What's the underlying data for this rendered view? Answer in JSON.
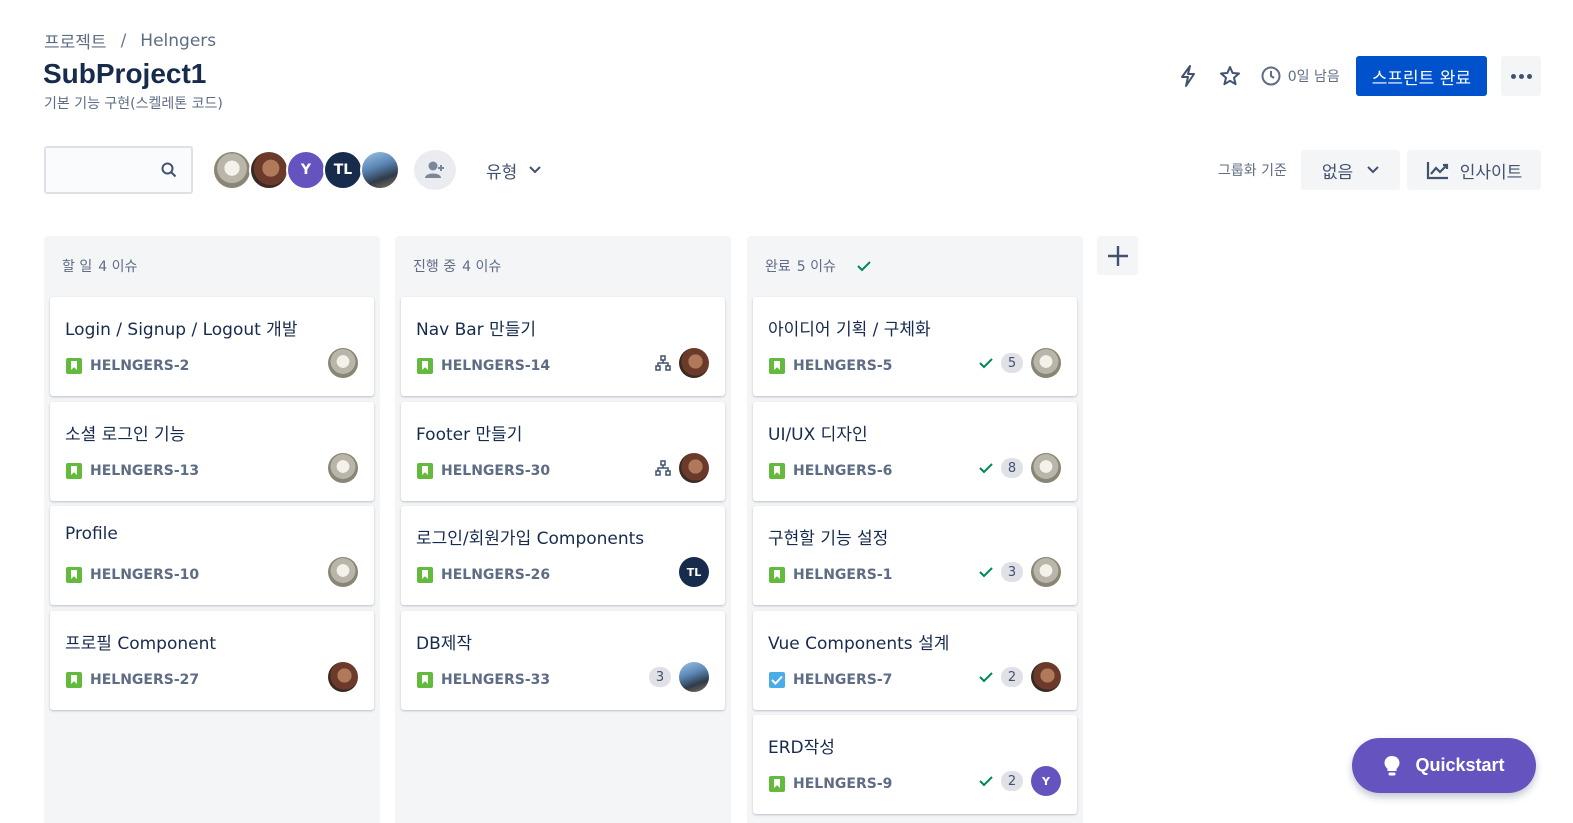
{
  "breadcrumb": {
    "root": "프로젝트",
    "separator": "/",
    "project": "Helngers"
  },
  "header": {
    "title": "SubProject1",
    "subtitle": "기본 기능 구현(스켈레톤 코드)"
  },
  "actions": {
    "remaining": "0일 남음",
    "complete_label": "스프린트 완료"
  },
  "filters": {
    "search_placeholder": "",
    "type_label": "유형",
    "group_label": "그룹화 기준",
    "group_value": "없음",
    "insight_label": "인사이트"
  },
  "avatars": [
    {
      "kind": "dog",
      "initials": ""
    },
    {
      "kind": "face",
      "initials": ""
    },
    {
      "kind": "y",
      "initials": "Y"
    },
    {
      "kind": "tl",
      "initials": "TL"
    },
    {
      "kind": "photo",
      "initials": ""
    }
  ],
  "columns": [
    {
      "name": "할 일",
      "count": "4 이슈",
      "done": false,
      "cards": [
        {
          "summary": "Login / Signup / Logout 개발",
          "key": "HELNGERS-2",
          "type": "story",
          "assignee": "dog"
        },
        {
          "summary": "소셜 로그인 기능",
          "key": "HELNGERS-13",
          "type": "story",
          "assignee": "dog"
        },
        {
          "summary": "Profile",
          "key": "HELNGERS-10",
          "type": "story",
          "assignee": "dog"
        },
        {
          "summary": "프로필 Component",
          "key": "HELNGERS-27",
          "type": "story",
          "assignee": "face"
        }
      ]
    },
    {
      "name": "진행 중",
      "count": "4 이슈",
      "done": false,
      "cards": [
        {
          "summary": "Nav Bar 만들기",
          "key": "HELNGERS-14",
          "type": "story",
          "assignee": "face",
          "subtasks": true
        },
        {
          "summary": "Footer 만들기",
          "key": "HELNGERS-30",
          "type": "story",
          "assignee": "face",
          "subtasks": true
        },
        {
          "summary": "로그인/회원가입 Components",
          "key": "HELNGERS-26",
          "type": "story",
          "assignee": "tl",
          "initials": "TL"
        },
        {
          "summary": "DB제작",
          "key": "HELNGERS-33",
          "type": "story",
          "assignee": "photo",
          "estimate": "3"
        }
      ]
    },
    {
      "name": "완료",
      "count": "5 이슈",
      "done": true,
      "cards": [
        {
          "summary": "아이디어 기획 / 구체화",
          "key": "HELNGERS-5",
          "type": "story",
          "assignee": "dog",
          "estimate": "5",
          "check": true
        },
        {
          "summary": "UI/UX 디자인",
          "key": "HELNGERS-6",
          "type": "story",
          "assignee": "dog",
          "estimate": "8",
          "check": true
        },
        {
          "summary": "구현할 기능 설정",
          "key": "HELNGERS-1",
          "type": "story",
          "assignee": "dog",
          "estimate": "3",
          "check": true
        },
        {
          "summary": "Vue Components 설계",
          "key": "HELNGERS-7",
          "type": "task",
          "assignee": "face",
          "estimate": "2",
          "check": true
        },
        {
          "summary": "ERD작성",
          "key": "HELNGERS-9",
          "type": "story",
          "assignee": "y",
          "initials": "Y",
          "estimate": "2",
          "check": true
        }
      ]
    }
  ],
  "quickstart": {
    "label": "Quickstart"
  },
  "colors": {
    "primary": "#0052cc",
    "story": "#63ba3c",
    "task": "#4bade8",
    "done_check": "#00875a",
    "quickstart": "#6554c0"
  }
}
